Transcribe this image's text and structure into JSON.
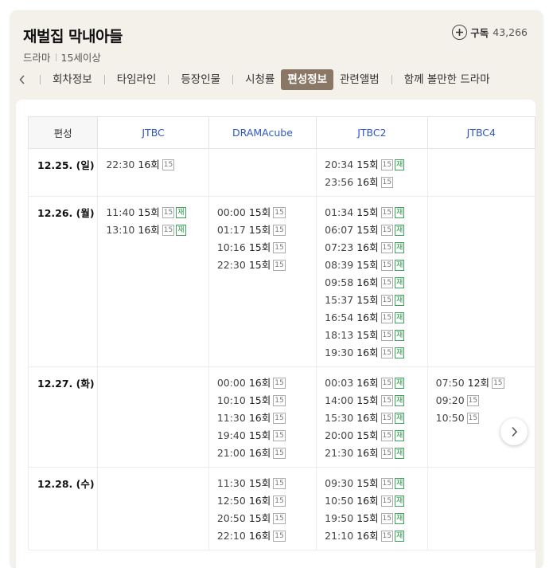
{
  "header": {
    "title": "재벌집 막내아들",
    "genre": "드라마",
    "rating": "15세이상",
    "subscribe_label": "구독",
    "subscribe_count": "43,266"
  },
  "tabs": [
    {
      "label": "회차정보"
    },
    {
      "label": "타임라인"
    },
    {
      "label": "등장인물"
    },
    {
      "label": "시청률"
    },
    {
      "label": "편성정보",
      "active": true
    },
    {
      "label": "관련앨범"
    },
    {
      "label": "함께 볼만한 드라마"
    }
  ],
  "schedule": {
    "date_header": "편성",
    "channels": [
      "JTBC",
      "DRAMAcube",
      "JTBC2",
      "JTBC4"
    ],
    "rows": [
      {
        "date": "12.25. (일)",
        "cells": [
          [
            {
              "time": "22:30",
              "ep": "16회",
              "age": "15"
            }
          ],
          [],
          [
            {
              "time": "20:34",
              "ep": "15회",
              "age": "15",
              "re": "재"
            },
            {
              "time": "23:56",
              "ep": "16회",
              "age": "15"
            }
          ],
          []
        ]
      },
      {
        "date": "12.26. (월)",
        "cells": [
          [
            {
              "time": "11:40",
              "ep": "15회",
              "age": "15",
              "re": "재"
            },
            {
              "time": "13:10",
              "ep": "16회",
              "age": "15",
              "re": "재"
            }
          ],
          [
            {
              "time": "00:00",
              "ep": "15회",
              "age": "15"
            },
            {
              "time": "01:17",
              "ep": "15회",
              "age": "15"
            },
            {
              "time": "10:16",
              "ep": "15회",
              "age": "15"
            },
            {
              "time": "22:30",
              "ep": "15회",
              "age": "15"
            }
          ],
          [
            {
              "time": "01:34",
              "ep": "15회",
              "age": "15",
              "re": "재"
            },
            {
              "time": "06:07",
              "ep": "15회",
              "age": "15",
              "re": "재"
            },
            {
              "time": "07:23",
              "ep": "16회",
              "age": "15",
              "re": "재"
            },
            {
              "time": "08:39",
              "ep": "15회",
              "age": "15",
              "re": "재"
            },
            {
              "time": "09:58",
              "ep": "16회",
              "age": "15",
              "re": "재"
            },
            {
              "time": "15:37",
              "ep": "15회",
              "age": "15",
              "re": "재"
            },
            {
              "time": "16:54",
              "ep": "16회",
              "age": "15",
              "re": "재"
            },
            {
              "time": "18:13",
              "ep": "15회",
              "age": "15",
              "re": "재"
            },
            {
              "time": "19:30",
              "ep": "16회",
              "age": "15",
              "re": "재"
            }
          ],
          []
        ]
      },
      {
        "date": "12.27. (화)",
        "cells": [
          [],
          [
            {
              "time": "00:00",
              "ep": "16회",
              "age": "15"
            },
            {
              "time": "10:10",
              "ep": "15회",
              "age": "15"
            },
            {
              "time": "11:30",
              "ep": "16회",
              "age": "15"
            },
            {
              "time": "19:40",
              "ep": "15회",
              "age": "15"
            },
            {
              "time": "21:00",
              "ep": "16회",
              "age": "15"
            }
          ],
          [
            {
              "time": "00:03",
              "ep": "16회",
              "age": "15",
              "re": "재"
            },
            {
              "time": "14:00",
              "ep": "15회",
              "age": "15",
              "re": "재"
            },
            {
              "time": "15:30",
              "ep": "16회",
              "age": "15",
              "re": "재"
            },
            {
              "time": "20:00",
              "ep": "15회",
              "age": "15",
              "re": "재"
            },
            {
              "time": "21:30",
              "ep": "16회",
              "age": "15",
              "re": "재"
            }
          ],
          [
            {
              "time": "07:50",
              "ep": "12회",
              "age": "15"
            },
            {
              "time": "09:20",
              "ep": "",
              "age": "15"
            },
            {
              "time": "10:50",
              "ep": "",
              "age": "15"
            }
          ]
        ]
      },
      {
        "date": "12.28. (수)",
        "cells": [
          [],
          [
            {
              "time": "11:30",
              "ep": "15회",
              "age": "15"
            },
            {
              "time": "12:50",
              "ep": "16회",
              "age": "15"
            },
            {
              "time": "20:50",
              "ep": "15회",
              "age": "15"
            },
            {
              "time": "22:10",
              "ep": "16회",
              "age": "15"
            }
          ],
          [
            {
              "time": "09:30",
              "ep": "15회",
              "age": "15",
              "re": "재"
            },
            {
              "time": "10:50",
              "ep": "16회",
              "age": "15",
              "re": "재"
            },
            {
              "time": "19:50",
              "ep": "15회",
              "age": "15",
              "re": "재"
            },
            {
              "time": "21:10",
              "ep": "16회",
              "age": "15",
              "re": "재"
            }
          ],
          []
        ]
      }
    ]
  },
  "colors": {
    "active_tab": "#8b7766",
    "channel_header": "#2f57c5",
    "rerun_badge": "#2b9148"
  },
  "icons": {
    "subscribe": "plus-icon",
    "tabs_prev": "chevron-left-icon",
    "table_next": "chevron-right-icon"
  }
}
